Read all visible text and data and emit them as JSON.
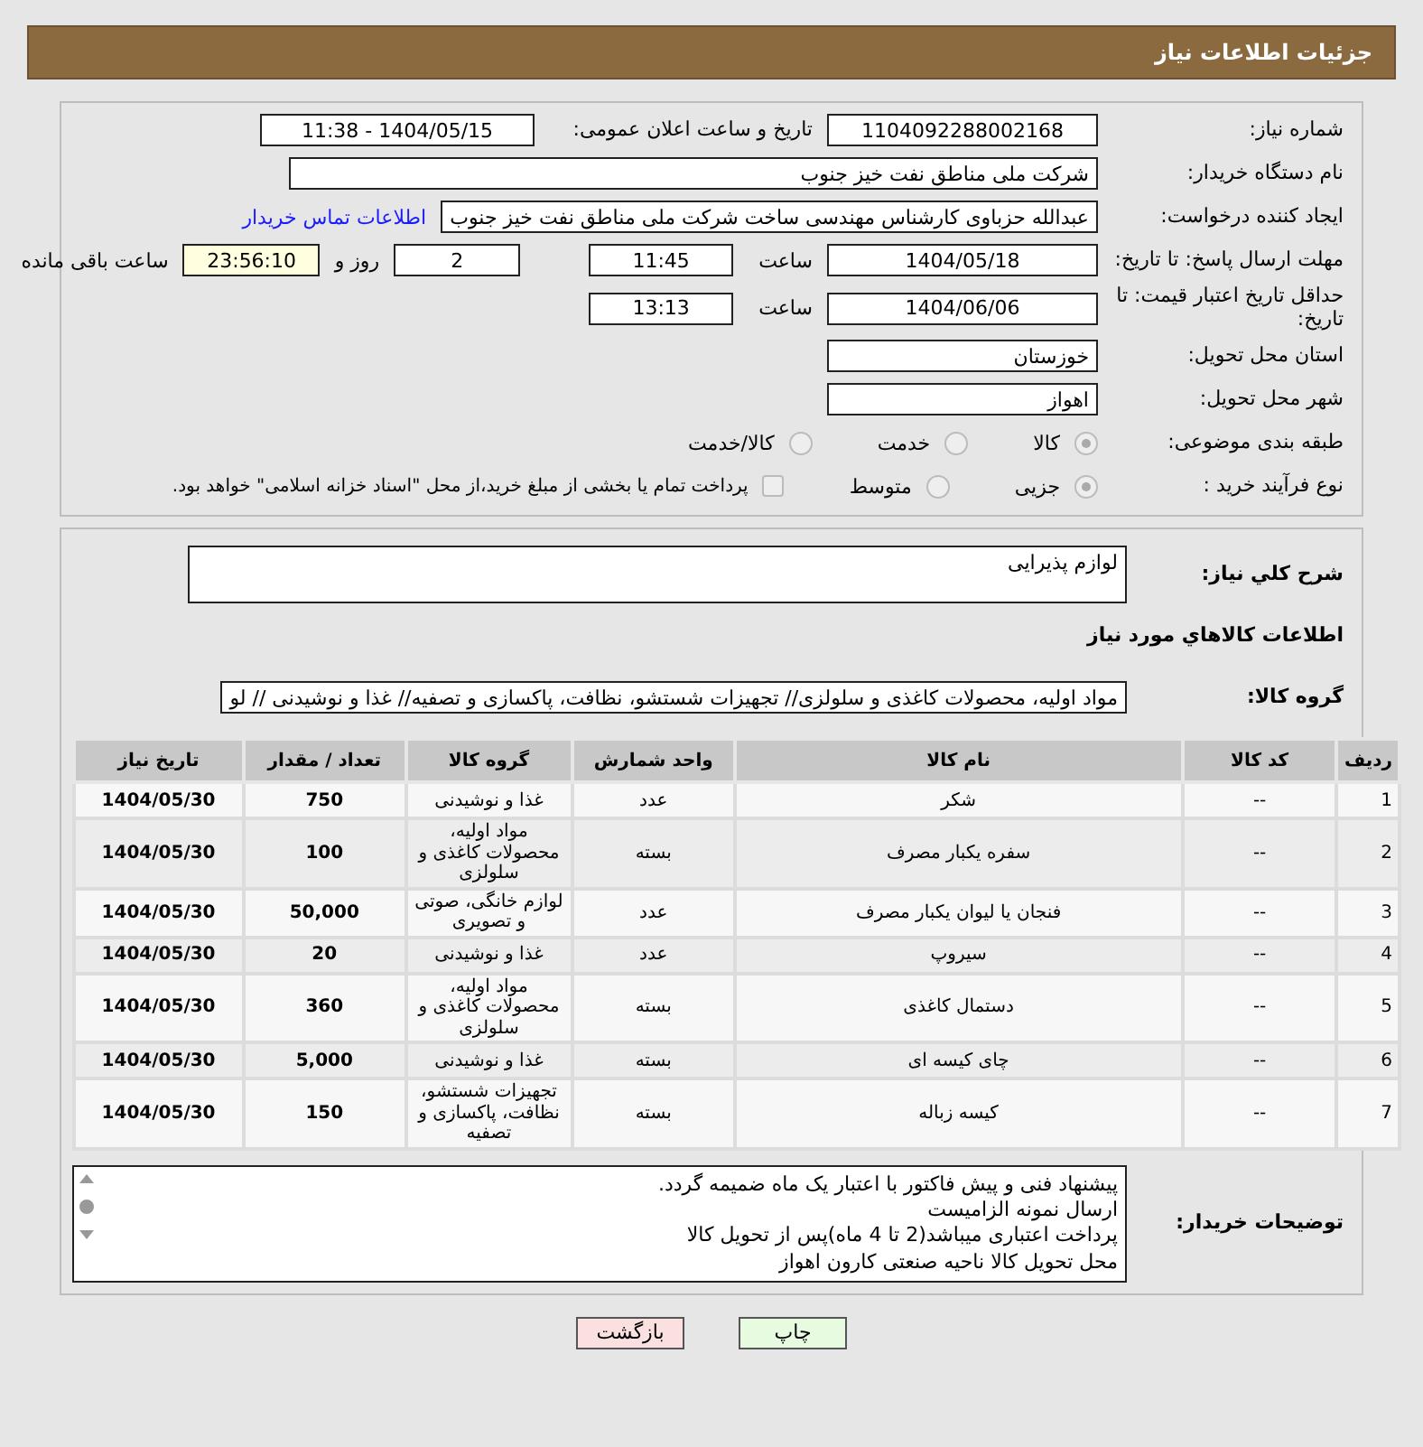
{
  "header": {
    "title": "جزئیات اطلاعات نیاز"
  },
  "need_number": {
    "label": "شماره نیاز:",
    "value": "1104092288002168"
  },
  "announce": {
    "label": "تاریخ و ساعت اعلان عمومی:",
    "value": "1404/05/15 - 11:38"
  },
  "buyer_org": {
    "label": "نام دستگاه خریدار:",
    "value": "شرکت ملی مناطق نفت خیز جنوب"
  },
  "requester": {
    "label": "ایجاد کننده درخواست:",
    "value": "عبدالله حزباوی کارشناس مهندسی ساخت شرکت ملی مناطق نفت خیز جنوب",
    "link": "اطلاعات تماس خریدار"
  },
  "response_deadline": {
    "label": "مهلت ارسال پاسخ: تا تاریخ:",
    "date": "1404/05/18",
    "time_label": "ساعت",
    "time": "11:45",
    "days": "2",
    "days_label": "روز و",
    "remaining": "23:56:10",
    "remaining_label": "ساعت باقی مانده"
  },
  "price_validity": {
    "label": "حداقل تاریخ اعتبار قیمت: تا تاریخ:",
    "date": "1404/06/06",
    "time_label": "ساعت",
    "time": "13:13"
  },
  "province": {
    "label": "استان محل تحویل:",
    "value": "خوزستان"
  },
  "city": {
    "label": "شهر محل تحویل:",
    "value": "اهواز"
  },
  "category": {
    "label": "طبقه بندی موضوعی:",
    "options": [
      {
        "label": "کالا",
        "selected": true
      },
      {
        "label": "خدمت",
        "selected": false
      },
      {
        "label": "کالا/خدمت",
        "selected": false
      }
    ]
  },
  "purchase_process": {
    "label": "نوع فرآیند خرید :",
    "options": [
      {
        "label": "جزیی",
        "selected": true
      },
      {
        "label": "متوسط",
        "selected": false
      }
    ],
    "payment_note": {
      "label": "پرداخت تمام یا بخشی از مبلغ خرید،از محل \"اسناد خزانه اسلامی\" خواهد بود.",
      "checked": false
    }
  },
  "description": {
    "label": "شرح کلي نياز:",
    "value": "لوازم پذیرایی"
  },
  "goods_title": "اطلاعات کالاهاي مورد نياز",
  "goods_group": {
    "label": "گروه کالا:",
    "value": "مواد اولیه، محصولات کاغذی و سلولزی// تجهیزات شستشو، نظافت، پاکسازی و تصفیه// غذا و نوشیدنی // لو"
  },
  "table": {
    "columns": [
      "ردیف",
      "کد کالا",
      "نام کالا",
      "واحد شمارش",
      "گروه کالا",
      "تعداد / مقدار",
      "تاریخ نیاز"
    ],
    "rows": [
      [
        "1",
        "--",
        "شکر",
        "عدد",
        "غذا و نوشیدنی",
        "750",
        "1404/05/30"
      ],
      [
        "2",
        "--",
        "سفره یکبار مصرف",
        "بسته",
        "مواد اولیه، محصولات کاغذی و سلولزی",
        "100",
        "1404/05/30"
      ],
      [
        "3",
        "--",
        "فنجان یا لیوان یکبار مصرف",
        "عدد",
        "لوازم خانگی، صوتی و تصویری",
        "50,000",
        "1404/05/30"
      ],
      [
        "4",
        "--",
        "سیروپ",
        "عدد",
        "غذا و نوشیدنی",
        "20",
        "1404/05/30"
      ],
      [
        "5",
        "--",
        "دستمال کاغذی",
        "بسته",
        "مواد اولیه، محصولات کاغذی و سلولزی",
        "360",
        "1404/05/30"
      ],
      [
        "6",
        "--",
        "چای کیسه ای",
        "بسته",
        "غذا و نوشیدنی",
        "5,000",
        "1404/05/30"
      ],
      [
        "7",
        "--",
        "کیسه زباله",
        "بسته",
        "تجهیزات شستشو، نظافت، پاکسازی و تصفیه",
        "150",
        "1404/05/30"
      ]
    ]
  },
  "buyer_notes": {
    "label": "توضیحات خریدار:",
    "lines": [
      "پیشنهاد فنی و پیش فاکتور با اعتبار یک ماه ضمیمه گردد.",
      "ارسال نمونه الزامیست",
      "پرداخت اعتباری میباشد(2 تا 4 ماه)پس از تحویل کالا",
      "محل تحویل کالا ناحیه صنعتی کارون اهواز"
    ]
  },
  "buttons": [
    {
      "label": "چاپ",
      "kind": "print"
    },
    {
      "label": "بازگشت",
      "kind": "back"
    }
  ]
}
